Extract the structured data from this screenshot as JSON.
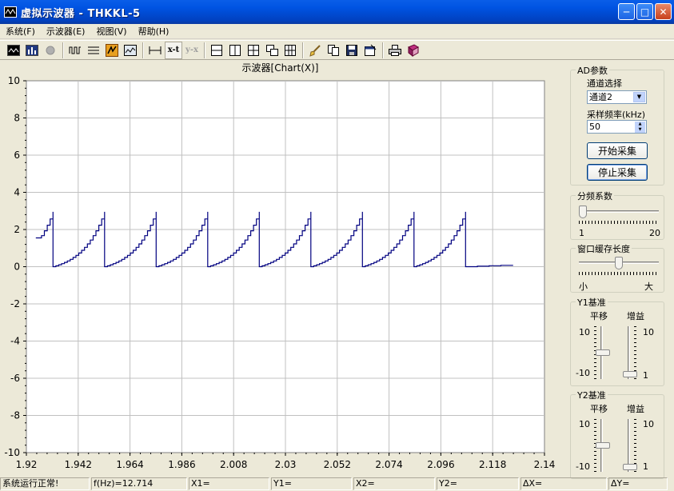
{
  "window": {
    "title": "虚拟示波器 - THKKL-5"
  },
  "menu": [
    "系统(F)",
    "示波器(E)",
    "视图(V)",
    "帮助(H)"
  ],
  "toolbar": {
    "xt_label": "x-t",
    "yx_label": "y-x"
  },
  "chart_data": {
    "type": "line",
    "title": "示波器[Chart(X)]",
    "xlim": [
      1.92,
      2.14
    ],
    "ylim": [
      -10,
      10
    ],
    "x_ticks": [
      "1.92",
      "1.942",
      "1.964",
      "1.986",
      "2.008",
      "2.03",
      "2.052",
      "2.074",
      "2.096",
      "2.118",
      "2.14"
    ],
    "y_ticks": [
      "10",
      "8",
      "6",
      "4",
      "2",
      "0",
      "-2",
      "-4",
      "-6",
      "-8",
      "-10"
    ],
    "grid": true,
    "series": [
      {
        "color": "#000080",
        "x_start": 1.924,
        "x_end": 2.1265,
        "period": 0.0219,
        "first_peak": 1.9313,
        "y_peak": 2.95,
        "y_start_partial": 1.55,
        "y_base": 0.0,
        "y_end": 0.1
      }
    ]
  },
  "ad_params": {
    "group_title": "AD参数",
    "channel_label": "通道选择",
    "channel_value": "通道2",
    "rate_label": "采样频率(kHz)",
    "rate_value": "50",
    "start_button": "开始采集",
    "stop_button": "停止采集"
  },
  "divider": {
    "group_title": "分频系数",
    "min": "1",
    "max": "20",
    "value": 1
  },
  "buffer": {
    "group_title": "窗口缓存长度",
    "min": "小",
    "max": "大",
    "value": 0.5
  },
  "y1": {
    "group_title": "Y1基准",
    "offset_label": "平移",
    "gain_label": "增益",
    "top": "10",
    "bottom": "-10",
    "gain_top": "10",
    "gain_bottom": "1"
  },
  "y2": {
    "group_title": "Y2基准",
    "offset_label": "平移",
    "gain_label": "增益",
    "top": "10",
    "bottom": "-10",
    "gain_top": "10",
    "gain_bottom": "1"
  },
  "status": {
    "state": "系统运行正常!",
    "freq": "f(Hz)=12.714",
    "x1": "X1=",
    "y1": "Y1=",
    "x2": "X2=",
    "y2": "Y2=",
    "dx": "ΔX=",
    "dy": "ΔY="
  },
  "colors": {
    "trace": "#000080",
    "grid": "#c0c0c0",
    "plot_bg": "#ffffff"
  }
}
